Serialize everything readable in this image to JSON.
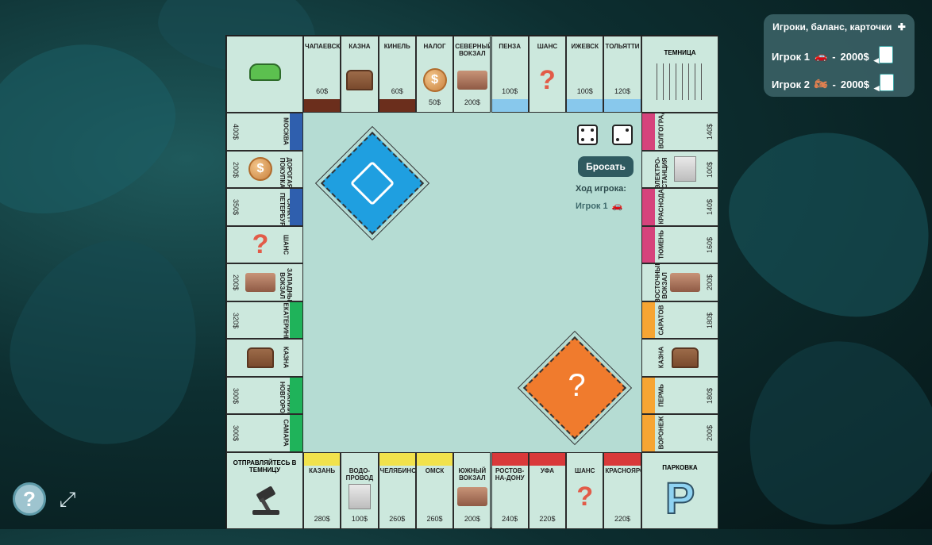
{
  "hud": {
    "title": "Игроки, баланс, карточки",
    "add_icon": "plus-icon",
    "players": [
      {
        "name": "Игрок 1",
        "token": "car-icon",
        "balance": "2000$",
        "sep": "-"
      },
      {
        "name": "Игрок 2",
        "token": "motorcycle-icon",
        "balance": "2000$",
        "sep": "-"
      }
    ]
  },
  "top": [
    {
      "name": "ЧАПАЕВСК",
      "price": "60$",
      "color": "#6b2e1c"
    },
    {
      "name": "КАЗНА",
      "price": "",
      "icon": "treasure-chest-icon"
    },
    {
      "name": "КИНЕЛЬ",
      "price": "60$",
      "color": "#6b2e1c"
    },
    {
      "name": "НАЛОГ",
      "price": "50$",
      "icon": "coin-icon"
    },
    {
      "name": "СЕВЕРНЫЙ ВОКЗАЛ",
      "price": "200$",
      "icon": "train-icon"
    },
    {
      "name": "ПЕНЗА",
      "price": "100$",
      "color": "#88c8ec"
    },
    {
      "name": "ШАНС",
      "price": "",
      "icon": "question-icon"
    },
    {
      "name": "ИЖЕВСК",
      "price": "100$",
      "color": "#88c8ec"
    },
    {
      "name": "ТОЛЬЯТТИ",
      "price": "120$",
      "color": "#88c8ec"
    }
  ],
  "left": [
    {
      "name": "МОСКВА",
      "price": "400$",
      "color": "#2f5fae"
    },
    {
      "name": "ДОРОГАЯ ПОКУПКА",
      "price": "200$",
      "icon": "coin-icon"
    },
    {
      "name": "САНКТ-ПЕТЕРБУРГ",
      "price": "350$",
      "color": "#2f5fae"
    },
    {
      "name": "ШАНС",
      "price": "",
      "icon": "question-icon"
    },
    {
      "name": "ЗАПАДНЫЙ ВОКЗАЛ",
      "price": "200$",
      "icon": "train-icon"
    },
    {
      "name": "ЕКАТЕРИНБУРГ",
      "price": "320$",
      "color": "#1fb35a"
    },
    {
      "name": "КАЗНА",
      "price": "",
      "icon": "treasure-chest-icon"
    },
    {
      "name": "НИЖНИЙ НОВГОРОД",
      "price": "300$",
      "color": "#1fb35a"
    },
    {
      "name": "САМАРА",
      "price": "300$",
      "color": "#1fb35a"
    }
  ],
  "right": [
    {
      "name": "ВОЛГОГРАД",
      "price": "140$",
      "color": "#d6437c"
    },
    {
      "name": "ЭЛЕКТРО-СТАНЦИЯ",
      "price": "100$",
      "icon": "power-station-icon"
    },
    {
      "name": "КРАСНОДАР",
      "price": "140$",
      "color": "#d6437c"
    },
    {
      "name": "ТЮМЕНЬ",
      "price": "160$",
      "color": "#d6437c"
    },
    {
      "name": "ВОСТОЧНЫЙ ВОКЗАЛ",
      "price": "200$",
      "icon": "train-icon"
    },
    {
      "name": "САРАТОВ",
      "price": "180$",
      "color": "#f6a533"
    },
    {
      "name": "КАЗНА",
      "price": "",
      "icon": "treasure-chest-icon"
    },
    {
      "name": "ПЕРМЬ",
      "price": "180$",
      "color": "#f6a533"
    },
    {
      "name": "ВОРОНЕЖ",
      "price": "200$",
      "color": "#f6a533"
    }
  ],
  "bottom": [
    {
      "name": "КАЗАНЬ",
      "price": "280$",
      "color": "#f1e24c"
    },
    {
      "name": "ВОДО-ПРОВОД",
      "price": "100$",
      "icon": "water-works-icon"
    },
    {
      "name": "ЧЕЛЯБИНСК",
      "price": "260$",
      "color": "#f1e24c"
    },
    {
      "name": "ОМСК",
      "price": "260$",
      "color": "#f1e24c"
    },
    {
      "name": "ЮЖНЫЙ ВОКЗАЛ",
      "price": "200$",
      "icon": "train-icon"
    },
    {
      "name": "РОСТОВ-НА-ДОНУ",
      "price": "240$",
      "color": "#d9393a"
    },
    {
      "name": "УФА",
      "price": "220$",
      "color": "#d9393a"
    },
    {
      "name": "ШАНС",
      "price": "",
      "icon": "question-icon"
    },
    {
      "name": "КРАСНОЯРСК",
      "price": "220$",
      "color": "#d9393a"
    }
  ],
  "corners": {
    "start": {
      "icon": "start-car-icon"
    },
    "jail": {
      "name": "ТЕМНИЦА"
    },
    "goto_jail": {
      "name": "ОТПРАВЛЯЙТЕСЬ В ТЕМНИЦУ"
    },
    "parking": {
      "name": "ПАРКОВКА",
      "letter": "P"
    }
  },
  "center": {
    "roll_button": "Бросать",
    "turn_label": "Ход игрока:",
    "current_player": "Игрок 1",
    "dice": [
      4,
      2
    ]
  },
  "footer": {
    "help": "?",
    "fullscreen_icon": "fullscreen-icon"
  }
}
